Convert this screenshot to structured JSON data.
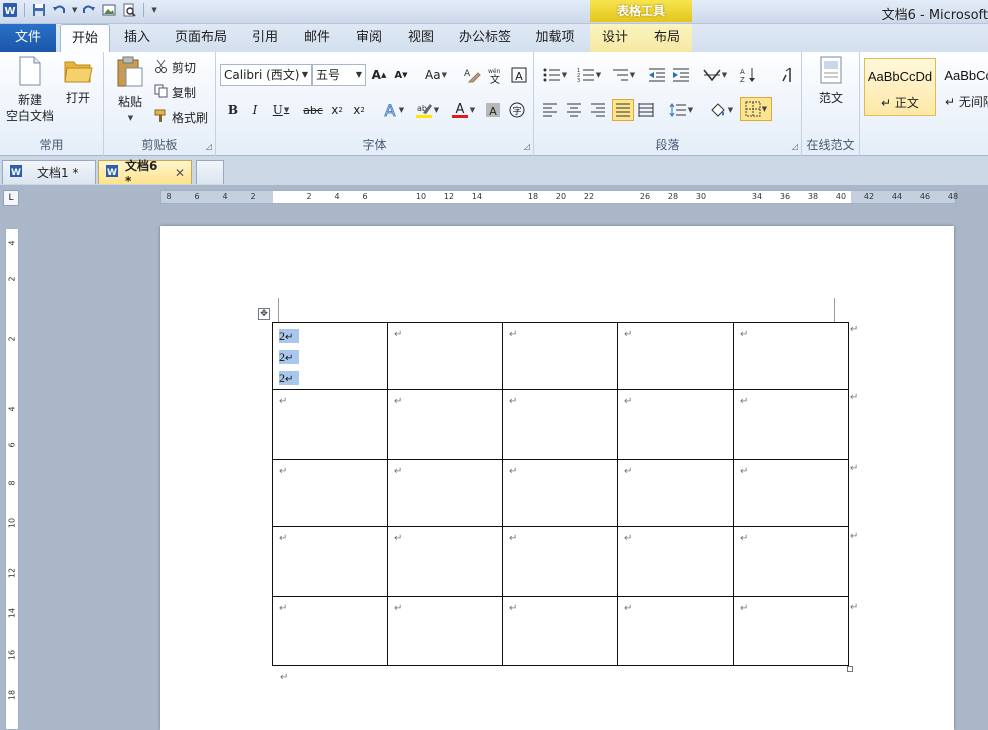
{
  "window": {
    "title": "文档6 - Microsoft",
    "context_tab_group": "表格工具"
  },
  "quick_access": {
    "icons": [
      "word-icon",
      "save-icon",
      "undo-icon",
      "redo-icon",
      "insert-picture-icon",
      "print-preview-icon",
      "customize-icon"
    ]
  },
  "ribbon_tabs": [
    {
      "label": "文件"
    },
    {
      "label": "开始"
    },
    {
      "label": "插入"
    },
    {
      "label": "页面布局"
    },
    {
      "label": "引用"
    },
    {
      "label": "邮件"
    },
    {
      "label": "审阅"
    },
    {
      "label": "视图"
    },
    {
      "label": "办公标签"
    },
    {
      "label": "加载项"
    },
    {
      "label": "设计"
    },
    {
      "label": "布局"
    }
  ],
  "active_tab": "开始",
  "groups": {
    "common": {
      "label": "常用",
      "new_doc": "新建\n空白文档",
      "new_doc_l1": "新建",
      "new_doc_l2": "空白文档",
      "open": "打开"
    },
    "clipboard": {
      "label": "剪贴板",
      "paste": "粘贴",
      "cut": "剪切",
      "copy": "复制",
      "format_painter": "格式刷"
    },
    "font": {
      "label": "字体",
      "font_name": "Calibri (西文)",
      "font_size": "五号"
    },
    "paragraph": {
      "label": "段落"
    },
    "online": {
      "label": "在线范文",
      "template": "范文"
    },
    "styles": {
      "style1_sample": "AaBbCcDd",
      "style1_name": "正文",
      "style2_sample": "AaBbCcI",
      "style2_name": "无间隔"
    }
  },
  "doc_tabs": [
    {
      "label": "文档1 *",
      "active": false
    },
    {
      "label": "文档6 *",
      "active": true
    }
  ],
  "ruler": {
    "h_numbers": [
      "8",
      "6",
      "4",
      "2",
      "2",
      "4",
      "6",
      "10",
      "12",
      "14",
      "18",
      "20",
      "22",
      "26",
      "28",
      "30",
      "34",
      "36",
      "38",
      "40",
      "42",
      "44",
      "46",
      "48"
    ],
    "v_numbers": [
      "4",
      "2",
      "2",
      "4",
      "6",
      "8",
      "10",
      "12",
      "14",
      "16",
      "18"
    ]
  },
  "table": {
    "rows": 5,
    "cols": 5,
    "first_cell_lines": [
      "2",
      "2",
      "2"
    ],
    "para_mark": "↵"
  },
  "colors": {
    "file_tab": "#1a56a8",
    "context_tab": "#e3c51c",
    "selection": "#a9c6ec"
  }
}
